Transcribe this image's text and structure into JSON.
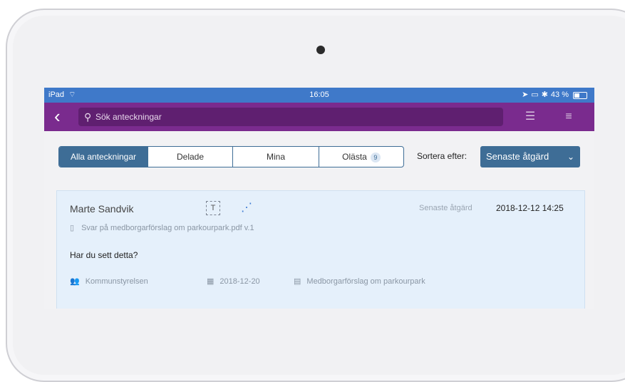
{
  "status_bar": {
    "left": "iPad",
    "time": "16:05",
    "battery": "43 %"
  },
  "toolbar": {
    "search_placeholder": "Sök anteckningar"
  },
  "tabs": [
    {
      "label": "Alla anteckningar",
      "active": true
    },
    {
      "label": "Delade",
      "active": false
    },
    {
      "label": "Mina",
      "active": false
    },
    {
      "label": "Olästa",
      "active": false,
      "badge": "9"
    }
  ],
  "sort": {
    "label": "Sortera efter:",
    "value": "Senaste åtgärd"
  },
  "note": {
    "author": "Marte Sandvik",
    "type_icon_text": "T",
    "last_action_label": "Senaste åtgärd",
    "last_action_date": "2018-12-12 14:25",
    "file": "Svar på medborgarförslag om parkourpark.pdf v.1",
    "comment": "Har du sett detta?",
    "group": "Kommunstyrelsen",
    "date": "2018-12-20",
    "case": "Medborgarförslag om parkourpark"
  },
  "colors": {
    "status_bar": "#3f79c9",
    "toolbar": "#7a2b8e",
    "accent": "#3e6d96",
    "card_bg": "#e5f0fb"
  }
}
